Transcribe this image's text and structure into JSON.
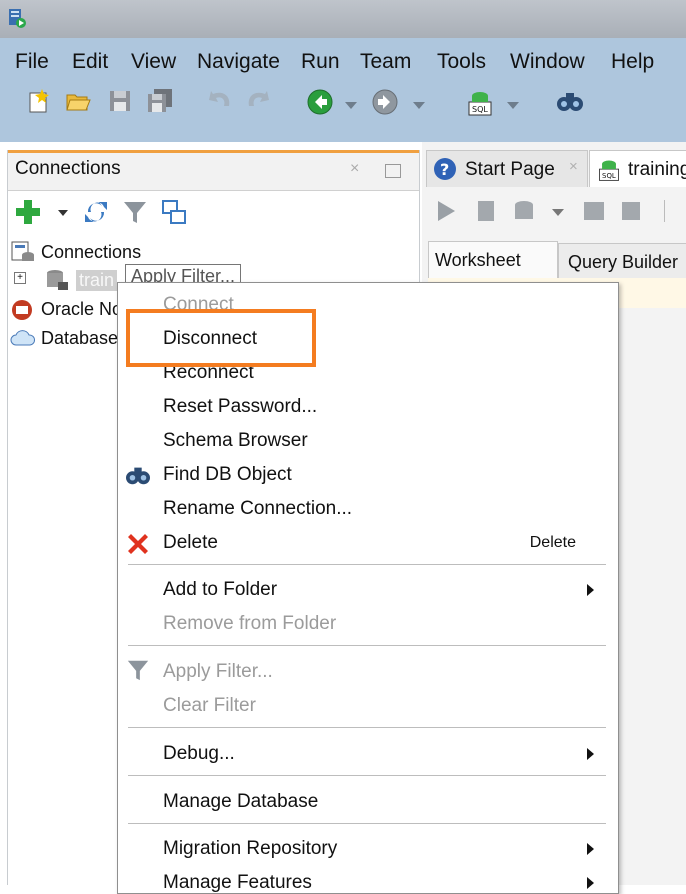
{
  "menubar": {
    "items": [
      "File",
      "Edit",
      "View",
      "Navigate",
      "Run",
      "Team",
      "Tools",
      "Window",
      "Help"
    ]
  },
  "toolbar": {
    "icons": [
      "new-icon",
      "open-folder-icon",
      "save-icon",
      "save-all-icon",
      "undo-icon",
      "redo-icon",
      "back-icon",
      "forward-icon",
      "sql-icon",
      "find-db-object-icon"
    ]
  },
  "connections_panel": {
    "title": "Connections",
    "tree": {
      "root": "Connections",
      "items": [
        "train",
        "Oracle No",
        "Database"
      ]
    }
  },
  "tooltip": "Apply Filter...",
  "editor_tabs": {
    "start_page": "Start Page",
    "training": "training"
  },
  "worksheet_tabs": [
    "Worksheet",
    "Query Builder"
  ],
  "context_menu": {
    "items": [
      {
        "label": "Connect",
        "enabled": false
      },
      {
        "label": "Disconnect",
        "enabled": true
      },
      {
        "label": "Reconnect",
        "enabled": true
      },
      {
        "label": "Reset Password...",
        "enabled": true
      },
      {
        "label": "Schema Browser",
        "enabled": true
      },
      {
        "label": "Find DB Object",
        "enabled": true
      },
      {
        "label": "Rename Connection...",
        "enabled": true
      },
      {
        "label": "Delete",
        "enabled": true,
        "shortcut": "Delete"
      },
      {
        "label": "Add to Folder",
        "enabled": true
      },
      {
        "label": "Remove from Folder",
        "enabled": false
      },
      {
        "label": "Apply Filter...",
        "enabled": false
      },
      {
        "label": "Clear Filter",
        "enabled": false
      },
      {
        "label": "Debug...",
        "enabled": true
      },
      {
        "label": "Manage Database",
        "enabled": true
      },
      {
        "label": "Migration Repository",
        "enabled": true
      },
      {
        "label": "Manage Features",
        "enabled": true
      }
    ]
  },
  "colors": {
    "highlight": "#f47c20",
    "menubar": "#aec6dd"
  }
}
